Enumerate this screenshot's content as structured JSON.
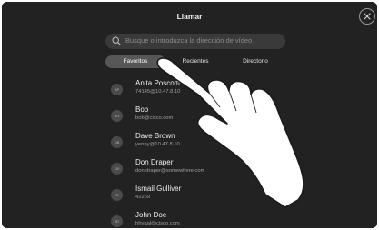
{
  "header": {
    "title": "Llamar"
  },
  "search": {
    "placeholder": "Busque o introduzca la dirección de vídeo"
  },
  "tabs": [
    {
      "label": "Favoritos",
      "active": true
    },
    {
      "label": "Recientes",
      "active": false
    },
    {
      "label": "Directorio",
      "active": false
    }
  ],
  "contacts": [
    {
      "initials": "AP",
      "name": "Anita Poscotti",
      "detail": "74145@10.47.8.10"
    },
    {
      "initials": "BO",
      "name": "Bob",
      "detail": "bob@cisco.com"
    },
    {
      "initials": "DB",
      "name": "Dave Brown",
      "detail": "yenny@10.47.8.10"
    },
    {
      "initials": "DD",
      "name": "Don Draper",
      "detail": "don.draper@somewhere.com"
    },
    {
      "initials": "IG",
      "name": "Ismail Gulliver",
      "detail": "42269"
    },
    {
      "initials": "JD",
      "name": "John Doe",
      "detail": "hhvaal@cisco.com"
    }
  ],
  "colors": {
    "background": "#222222",
    "active_tab": "#575757",
    "search_bg": "#3a3a3a"
  },
  "icons": {
    "close": "close-icon",
    "search": "search-icon",
    "hand": "hand-pointer-icon"
  }
}
